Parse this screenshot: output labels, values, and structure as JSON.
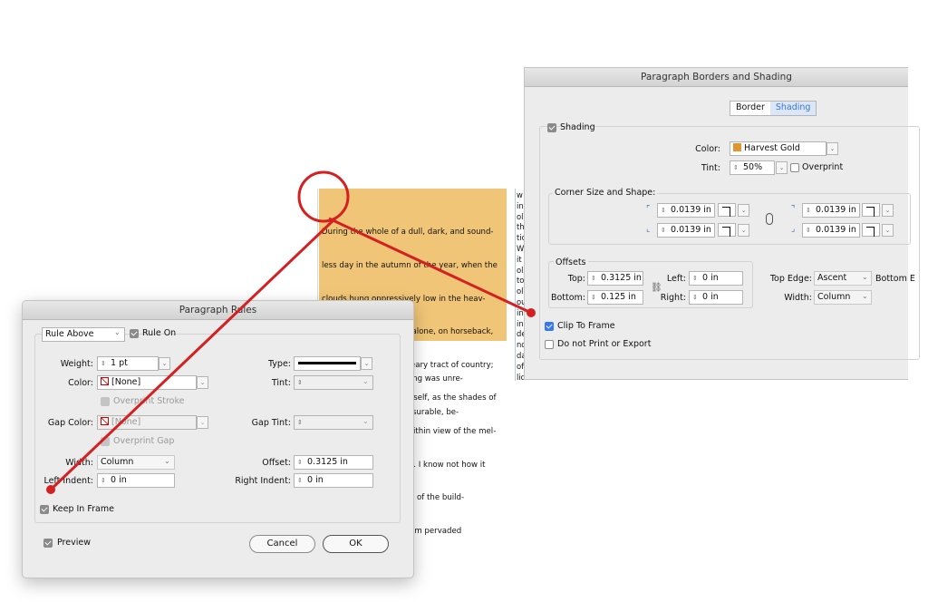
{
  "text_frame": {
    "shaded_lines": [
      "During the whole of a dull, dark, and sound-",
      "less day in the autumn of the year, when the",
      "clouds hung oppressively low in the heav-",
      "ens, had been passing alone, on horseback,",
      "through a singularly dreary tract of country;",
      "and at length found myself, as the shades of",
      "the evening drew on, within view of the mel-",
      "ancholy House of Usher. I know not how it",
      "                       : glimpse of the build-",
      "                       able gloom pervaded"
    ],
    "plain_lines": [
      "                         he feeling was unre-",
      "                         alf-pleasurable, be-"
    ],
    "column2_letters": [
      "w",
      "in",
      "ol",
      "th",
      "tio",
      "W",
      "it",
      "ol",
      "to",
      "ol",
      "ou",
      "in",
      "in",
      "de",
      "nd",
      "da",
      "of",
      "lic"
    ]
  },
  "paragraph_rules": {
    "title": "Paragraph Rules",
    "rule_select": "Rule Above",
    "rule_on_label": "Rule On",
    "weight_label": "Weight:",
    "weight_value": "1 pt",
    "type_label": "Type:",
    "color_label": "Color:",
    "color_value": "[None]",
    "tint_label": "Tint:",
    "overprint_stroke_label": "Overprint Stroke",
    "gap_color_label": "Gap Color:",
    "gap_color_value": "[None]",
    "gap_tint_label": "Gap Tint:",
    "overprint_gap_label": "Overprint Gap",
    "width_label": "Width:",
    "width_value": "Column",
    "offset_label": "Offset:",
    "offset_value": "0.3125 in",
    "left_indent_label": "Left Indent:",
    "left_indent_value": "0 in",
    "right_indent_label": "Right Indent:",
    "right_indent_value": "0 in",
    "keep_in_frame_label": "Keep In Frame",
    "preview_label": "Preview",
    "cancel_label": "Cancel",
    "ok_label": "OK"
  },
  "borders_shading": {
    "title": "Paragraph Borders and Shading",
    "tabs": [
      "Border",
      "Shading"
    ],
    "shading_label": "Shading",
    "color_label": "Color:",
    "color_value": "Harvest Gold",
    "tint_label": "Tint:",
    "tint_value": "50%",
    "overprint_label": "Overprint",
    "corner_label": "Corner Size and Shape:",
    "corner_values": [
      "0.0139 in",
      "0.0139 in",
      "0.0139 in",
      "0.0139 in"
    ],
    "offsets_label": "Offsets",
    "top_label": "Top:",
    "top_value": "0.3125 in",
    "bottom_label": "Bottom:",
    "bottom_value": "0.125 in",
    "left_label": "Left:",
    "left_value": "0 in",
    "right_label": "Right:",
    "right_value": "0 in",
    "top_edge_label": "Top Edge:",
    "top_edge_value": "Ascent",
    "bottom_edge_label": "Bottom E",
    "width_label": "Width:",
    "width_value": "Column",
    "clip_label": "Clip To Frame",
    "no_print_label": "Do not Print or Export"
  },
  "colors": {
    "shading": "#f0c577",
    "accent": "#d42020",
    "checkbox_blue": "#3478f6",
    "harvest_gold": "#e0952e"
  }
}
